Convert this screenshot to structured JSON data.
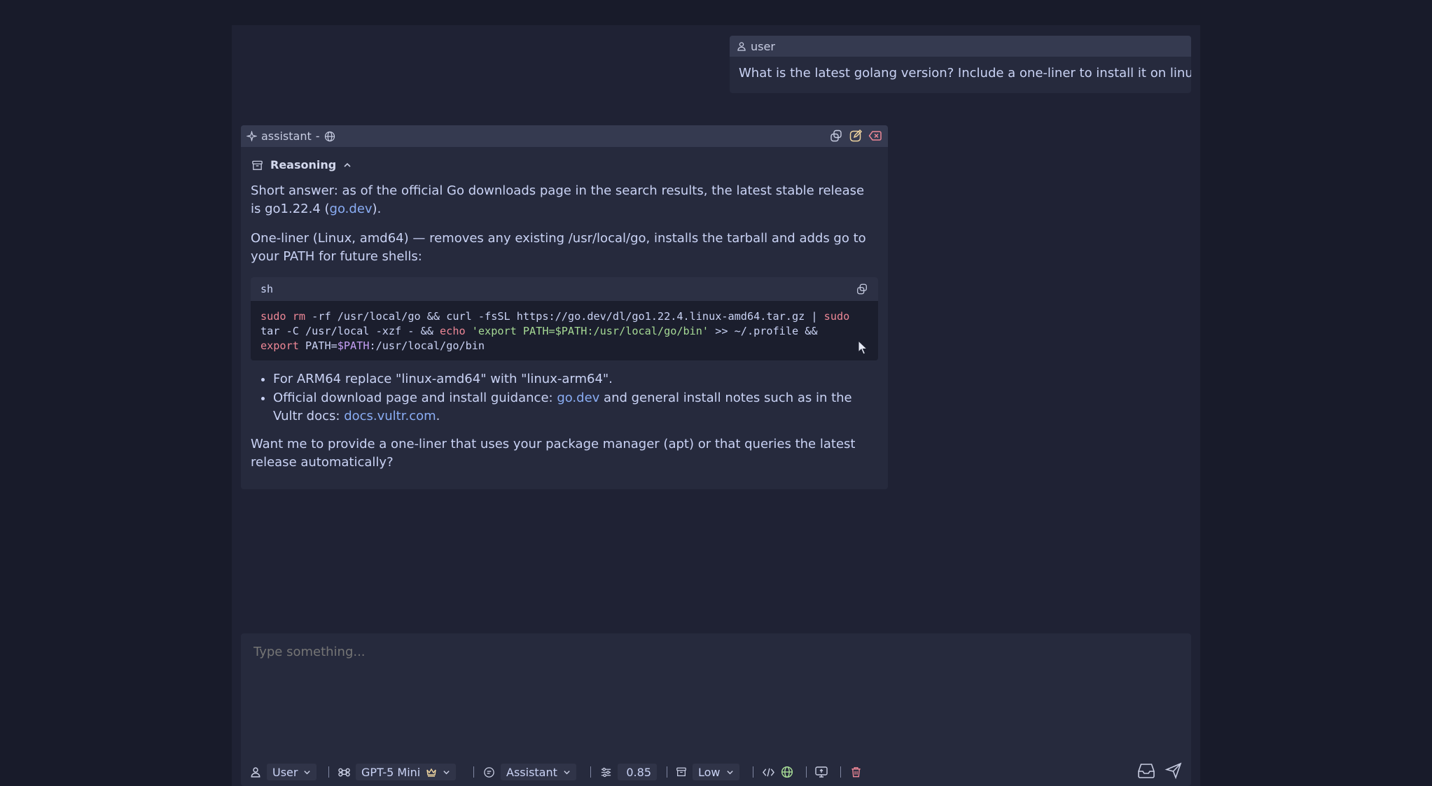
{
  "user_message": {
    "role": "user",
    "text": "What is the latest golang version? Include a one-liner to install it on linux."
  },
  "assistant_message": {
    "role": "assistant",
    "separator": "-",
    "reasoning_label": "Reasoning",
    "p1_a": "Short answer: as of the official Go downloads page in the search results, the latest stable release is go1.22.4 (",
    "p1_link": "go.dev",
    "p1_b": ").",
    "p2": "One-liner (Linux, amd64) — removes any existing /usr/local/go, installs the tarball and adds go to your PATH for future shells:",
    "code": {
      "lang": "sh",
      "t1": "sudo",
      "t2": " ",
      "t3": "rm",
      "t4": " -rf /usr/local/go && curl -fsSL https://go.dev/dl/go1.22.4.linux-amd64.tar.gz | ",
      "t5": "sudo",
      "t6": "\ntar -C /usr/local -xzf - && ",
      "t7": "echo",
      "t8": " ",
      "t9": "'export PATH=$PATH:/usr/local/go/bin'",
      "t10": " >> ~/.profile &&\n",
      "t11": "export",
      "t12": " PATH=",
      "t13": "$PATH",
      "t14": ":/usr/local/go/bin"
    },
    "bullet1": "For ARM64 replace \"linux-amd64\" with \"linux-arm64\".",
    "bullet2_a": "Official download page and install guidance: ",
    "bullet2_link1": "go.dev",
    "bullet2_b": " and general install notes such as in the Vultr docs: ",
    "bullet2_link2": "docs.vultr.com",
    "bullet2_c": ".",
    "p3": "Want me to provide a one-liner that uses your package manager (apt) or that queries the latest release automatically?"
  },
  "composer": {
    "placeholder": "Type something..."
  },
  "toolbar": {
    "user_role": "User",
    "model": "GPT-5 Mini",
    "assistant_role": "Assistant",
    "temperature": "0.85",
    "reasoning_effort": "Low"
  },
  "colors": {
    "accent_link": "#8aadf4",
    "keyword": "#ed8796",
    "string": "#a6da95",
    "variable": "#c6a0f6",
    "crown": "#eed49f",
    "delete": "#ed8796",
    "globe_green": "#a6da95"
  }
}
